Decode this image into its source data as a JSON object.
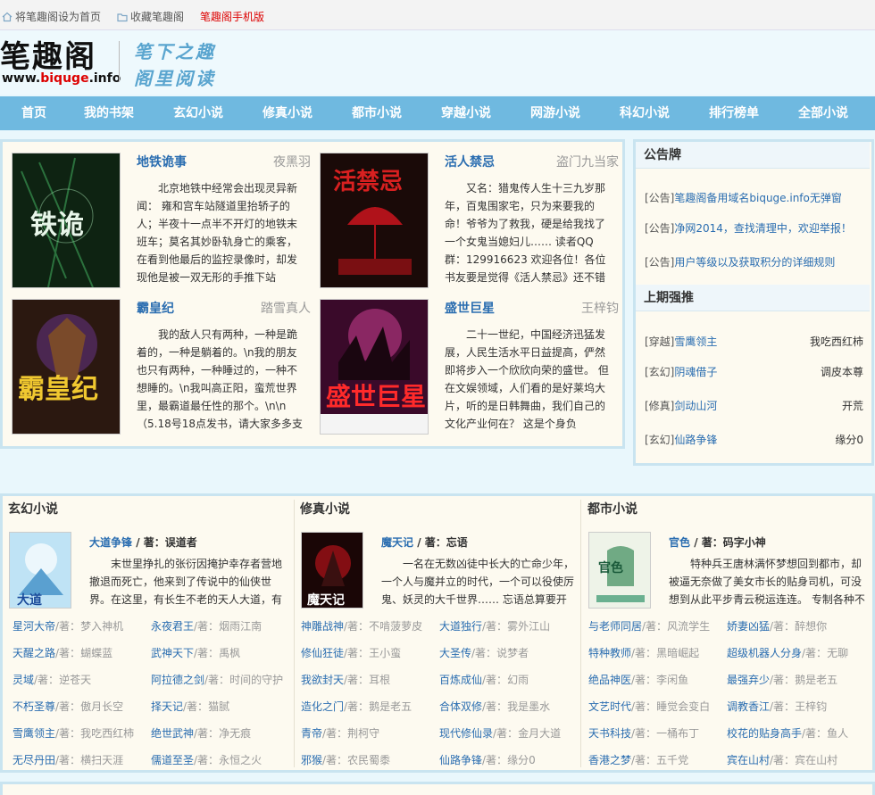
{
  "topbar": {
    "set_home": "将笔趣阁设为首页",
    "bookmark": "收藏笔趣阁",
    "mobile": "笔趣阁手机版"
  },
  "logo": {
    "name": "笔趣阁",
    "url_prefix": "www.",
    "url_mid": "biquge",
    "url_suffix": ".info",
    "slogan_line1": "笔下之趣",
    "slogan_line2": "阁里阅读"
  },
  "nav": [
    "首页",
    "我的书架",
    "玄幻小说",
    "修真小说",
    "都市小说",
    "穿越小说",
    "网游小说",
    "科幻小说",
    "排行榜单",
    "全部小说"
  ],
  "featured": [
    {
      "title": "地铁诡事",
      "author": "夜黑羽",
      "desc": "北京地铁中经常会出现灵异新闻： 雍和宫车站隧道里抬轿子的人；半夜十一点半不开灯的地铁末班车；莫名其妙卧轨身亡的乘客，在看到他最后的监控录像时，却发现他是被一双无形的手推下站"
    },
    {
      "title": "活人禁忌",
      "author": "盗门九当家",
      "desc": "又名：猎鬼传人生十三九岁那年，百鬼围家宅，只为来要我的命！爷爷为了救我，硬是给我找了一个女鬼当媳妇儿…… 读者QQ群：129916623 欢迎各位！各位书友要是觉得《活人禁忌》还不错的话请"
    },
    {
      "title": "霸皇纪",
      "author": "踏雪真人",
      "desc": "我的敌人只有两种，一种是跪着的，一种是躺着的。\\n我的朋友也只有两种，一种睡过的，一种不想睡的。\\n我叫高正阳，蛮荒世界里，最霸道最任性的那个。\\n\\n（5.18号18点发书，请大家多多支"
    },
    {
      "title": "盛世巨星",
      "author": "王梓钧",
      "desc": "二十一世纪，中国经济迅猛发展，人民生活水平日益提高，俨然即将步入一个欣欣向荣的盛世。 但在文娱领域，人们看的是好莱坞大片，听的是日韩舞曲，我们自己的文化产业何在？ 这是个身负"
    }
  ],
  "notices": {
    "title": "公告牌",
    "items": [
      {
        "tag": "[公告]",
        "text": "笔趣阁备用域名biquge.info无弹窗"
      },
      {
        "tag": "[公告]",
        "text": "净网2014，查找清理中，欢迎举报！"
      },
      {
        "tag": "[公告]",
        "text": "用户等级以及获取积分的详细规则"
      }
    ]
  },
  "ranking": {
    "title": "上期强推",
    "items": [
      {
        "cat": "[穿越]",
        "book": "雪鹰领主",
        "author": "我吃西红柿"
      },
      {
        "cat": "[玄幻]",
        "book": "阴魂借子",
        "author": "调皮本尊"
      },
      {
        "cat": "[修真]",
        "book": "剑动山河",
        "author": "开荒"
      },
      {
        "cat": "[玄幻]",
        "book": "仙路争锋",
        "author": "缘分0"
      }
    ]
  },
  "categories": [
    {
      "title": "玄幻小说",
      "head_book": "大道争锋",
      "head_author": "著：误道者",
      "head_desc": "末世里挣扎的张衍因掩护幸存者营地撤退而死亡，他来到了传说中的仙侠世界。在这里，有长生不老的天人大道，有移山",
      "items": [
        {
          "book": "星河大帝",
          "author": "梦入神机"
        },
        {
          "book": "永夜君王",
          "author": "烟雨江南"
        },
        {
          "book": "天醒之路",
          "author": "蝴蝶蓝"
        },
        {
          "book": "武神天下",
          "author": "禹枫"
        },
        {
          "book": "灵域",
          "author": "逆苍天"
        },
        {
          "book": "阿拉德之剑",
          "author": "时间的守护"
        },
        {
          "book": "不朽圣尊",
          "author": "傲月长空"
        },
        {
          "book": "择天记",
          "author": "猫腻"
        },
        {
          "book": "雪鹰领主",
          "author": "我吃西红柿"
        },
        {
          "book": "绝世武神",
          "author": "净无痕"
        },
        {
          "book": "无尽丹田",
          "author": "横扫天涯"
        },
        {
          "book": "儒道至圣",
          "author": "永恒之火"
        }
      ]
    },
    {
      "title": "修真小说",
      "head_book": "魔天记",
      "head_author": "著：忘语",
      "head_desc": "一名在无数凶徒中长大的亡命少年，一个人与魔并立的时代，一个可以役使厉鬼、妖灵的大千世界…… 忘语总算要开",
      "items": [
        {
          "book": "神雕战神",
          "author": "不啃菠萝皮"
        },
        {
          "book": "大道独行",
          "author": "雾外江山"
        },
        {
          "book": "修仙狂徒",
          "author": "王小蛮"
        },
        {
          "book": "大圣传",
          "author": "说梦者"
        },
        {
          "book": "我欲封天",
          "author": "耳根"
        },
        {
          "book": "百炼成仙",
          "author": "幻雨"
        },
        {
          "book": "造化之门",
          "author": "鹅是老五"
        },
        {
          "book": "合体双修",
          "author": "我是墨水"
        },
        {
          "book": "青帝",
          "author": "荆柯守"
        },
        {
          "book": "现代修仙录",
          "author": "金月大道"
        },
        {
          "book": "邪猴",
          "author": "农民蜀黍"
        },
        {
          "book": "仙路争锋",
          "author": "缘分0"
        }
      ]
    },
    {
      "title": "都市小说",
      "head_book": "官色",
      "head_author": "著：码字小神",
      "head_desc": "特种兵王唐林满怀梦想回到都市，却被逼无奈做了美女市长的贴身司机，可没想到从此平步青云税运连连。 专制各种不服",
      "items": [
        {
          "book": "与老师同居",
          "author": "风流学生"
        },
        {
          "book": "娇妻凶猛",
          "author": "醉想你"
        },
        {
          "book": "特种教师",
          "author": "黑暗崛起"
        },
        {
          "book": "超级机器人分身",
          "author": "无聊"
        },
        {
          "book": "绝品神医",
          "author": "李闲鱼"
        },
        {
          "book": "最强弃少",
          "author": "鹅是老五"
        },
        {
          "book": "文艺时代",
          "author": "睡觉会变白"
        },
        {
          "book": "调教香江",
          "author": "王梓钧"
        },
        {
          "book": "天书科技",
          "author": "一桶布丁"
        },
        {
          "book": "校花的贴身高手",
          "author": "鱼人"
        },
        {
          "book": "香港之梦",
          "author": "五千党"
        },
        {
          "book": "宾在山村",
          "author": "宾在山村"
        }
      ]
    }
  ],
  "colors": {
    "nav_bg": "#6fb9e0",
    "link": "#2a6db0",
    "panel_border": "#c9e4f0",
    "panel_bg": "#fdfaf0"
  }
}
